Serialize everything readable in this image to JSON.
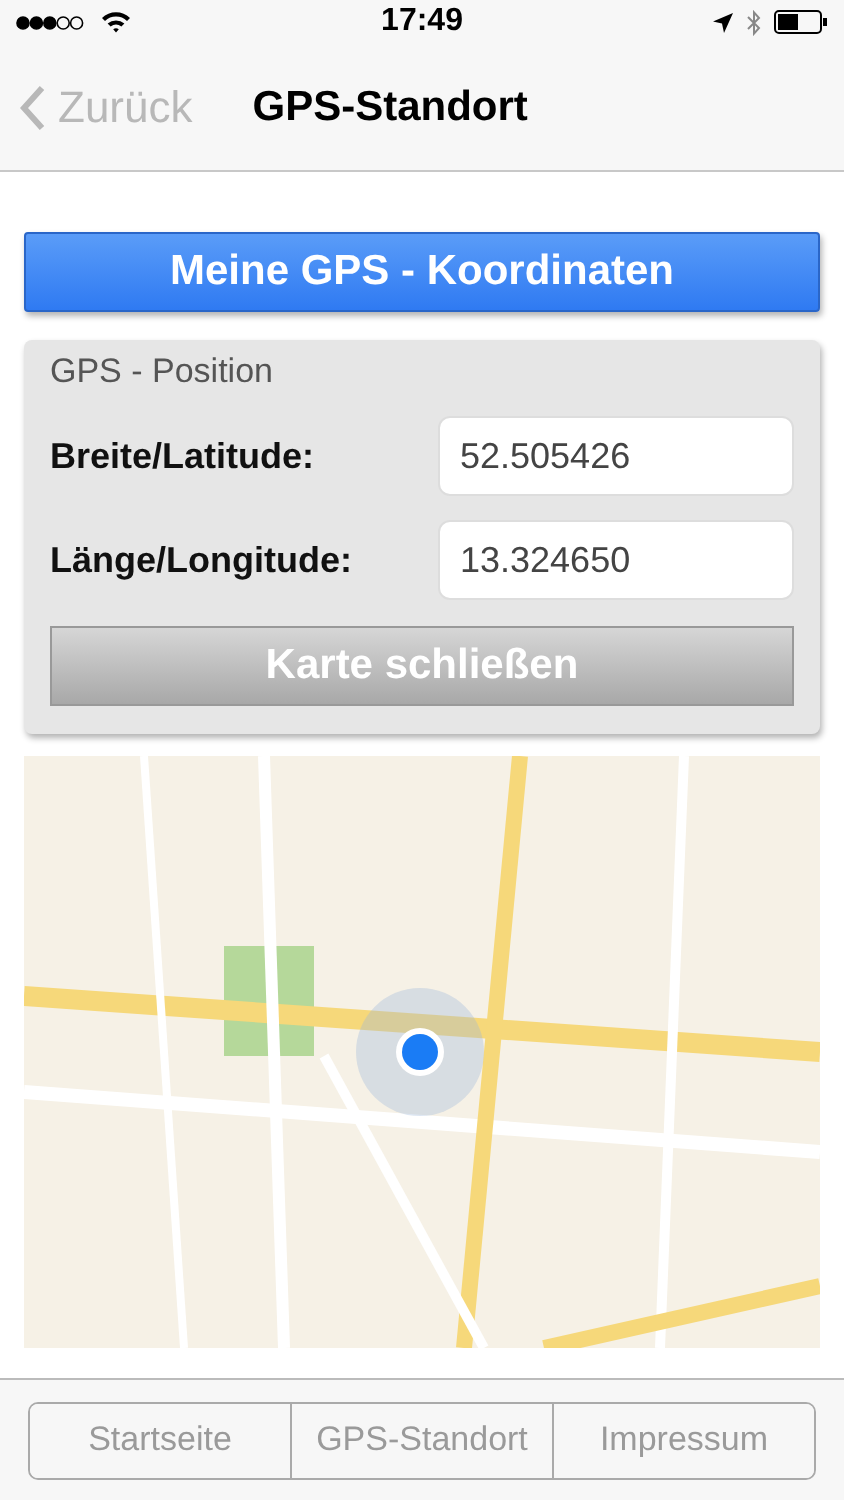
{
  "status_bar": {
    "time": "17:49"
  },
  "nav": {
    "back": "Zurück",
    "title": "GPS-Standort"
  },
  "coords_button": "Meine GPS - Koordinaten",
  "panel": {
    "title": "GPS - Position",
    "fields": [
      {
        "label": "Breite/Latitude:",
        "value": "52.505426"
      },
      {
        "label": "Länge/Longitude:",
        "value": "13.324650"
      }
    ],
    "close_button": "Karte schließen"
  },
  "segments": [
    {
      "label": "Startseite",
      "selected": false
    },
    {
      "label": "GPS-Standort",
      "selected": false
    },
    {
      "label": "Impressum",
      "selected": false
    }
  ]
}
